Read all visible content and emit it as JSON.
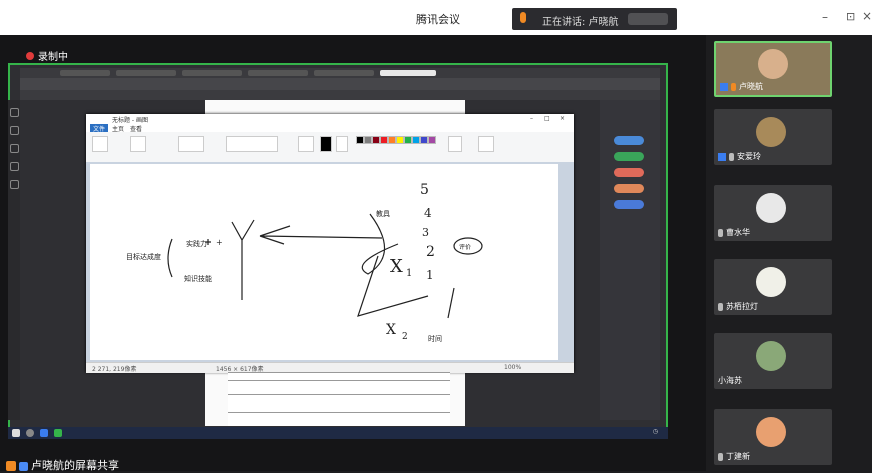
{
  "window": {
    "title": "腾讯会议",
    "speaking_label": "正在讲话: 卢晓航",
    "min": "–",
    "max": "⊡",
    "close": "×"
  },
  "recording": "录制中",
  "paint": {
    "app_name": "无标题 - 画图",
    "menu": {
      "file": "文件",
      "home": "主页",
      "view": "查看"
    },
    "status_size": "2 271, 219像素",
    "status_canvas": "1456 × 617像素",
    "zoom": "100%"
  },
  "handwriting": {
    "goal": "目标达成度",
    "practice": "实践力",
    "plus": "+",
    "knowledge": "知识技能",
    "teacher": "教具",
    "evaluate": "评价",
    "time": "时间",
    "x1": "X",
    "sub1": "1",
    "x2": "X",
    "sub2": "2",
    "n5": "5",
    "n4": "4",
    "n3": "3",
    "n2": "2",
    "n1": "1"
  },
  "sharer": "卢晓航的屏幕共享",
  "participants": [
    {
      "name": "卢晓航",
      "speaking": true
    },
    {
      "name": "安爱玲",
      "speaking": false
    },
    {
      "name": "曹水华",
      "speaking": false
    },
    {
      "name": "苏栢拉灯",
      "speaking": false
    },
    {
      "name": "小海苏",
      "speaking": false
    },
    {
      "name": "丁建新",
      "speaking": false
    }
  ],
  "colors": {
    "accent_green": "#35b44a",
    "mic_orange": "#f08a24"
  }
}
